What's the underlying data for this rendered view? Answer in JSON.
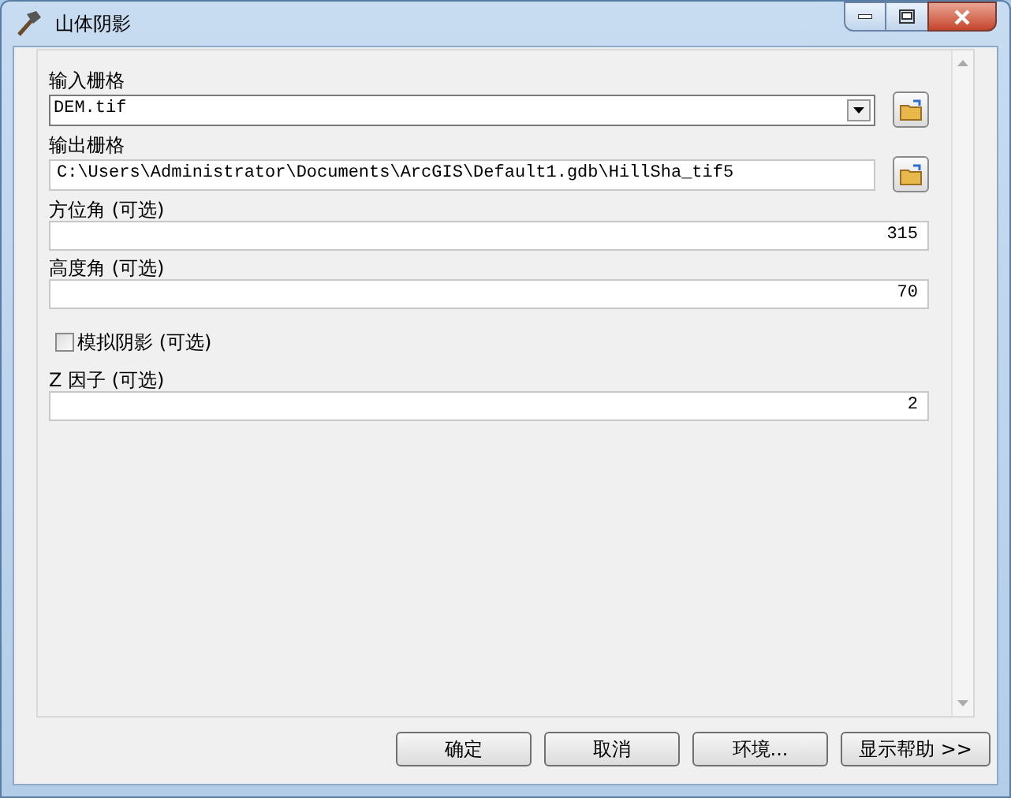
{
  "window": {
    "title": "山体阴影"
  },
  "parameters": [
    {
      "kind": "dropdown",
      "label": "输入栅格",
      "value": "DEM.tif"
    },
    {
      "kind": "path",
      "label": "输出栅格",
      "value": "C:\\Users\\Administrator\\Documents\\ArcGIS\\Default1.gdb\\HillSha_tif5"
    },
    {
      "kind": "number",
      "label": "方位角 (可选)",
      "value": "315"
    },
    {
      "kind": "number",
      "label": "高度角 (可选)",
      "value": "70"
    },
    {
      "kind": "checkbox",
      "label": "模拟阴影 (可选)",
      "checked": false
    },
    {
      "kind": "number",
      "label": "Z 因子 (可选)",
      "value": "2"
    }
  ],
  "buttons": [
    "确定",
    "取消",
    "环境...",
    "显示帮助 >>"
  ]
}
